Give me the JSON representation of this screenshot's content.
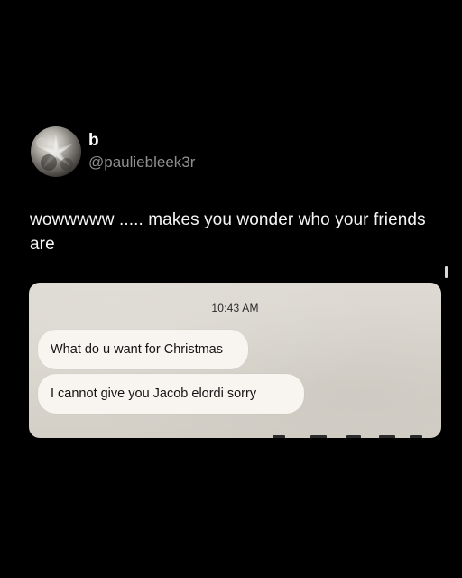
{
  "post": {
    "display_name": "b",
    "handle": "@pauliebleek3r",
    "text": "wowwwww ..... makes you wonder who your friends are",
    "avatar_icon": "avatar-photo-icon"
  },
  "screenshot": {
    "timestamp": "10:43 AM",
    "messages": [
      {
        "text": "What do u want for Christmas"
      },
      {
        "text": "I cannot give you Jacob elordi sorry"
      }
    ]
  },
  "colors": {
    "background": "#000000",
    "handle": "#8f8f8f",
    "screenshot_bg": "#dad6cf",
    "bubble": "#f8f5f0"
  }
}
